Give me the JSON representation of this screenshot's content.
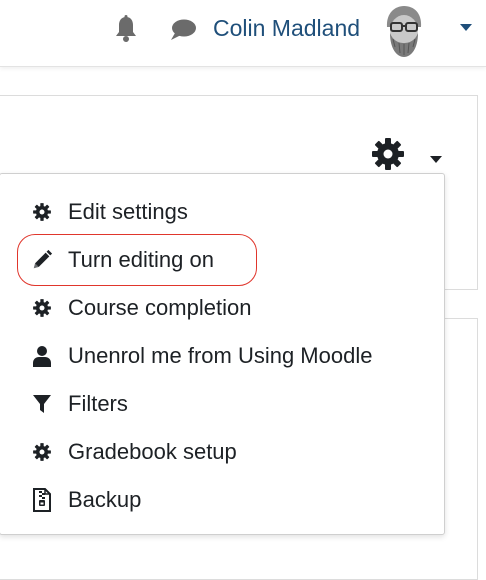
{
  "navbar": {
    "notifications_icon": "bell-icon",
    "messages_icon": "chat-bubble-icon",
    "user_name": "Colin Madland",
    "user_menu_icon": "caret-down-icon"
  },
  "course_actions": {
    "settings_icon": "gear-icon",
    "caret_icon": "caret-down-icon"
  },
  "menu": {
    "items": [
      {
        "label": "Edit settings",
        "icon": "gear-icon"
      },
      {
        "label": "Turn editing on",
        "icon": "pencil-icon"
      },
      {
        "label": "Course completion",
        "icon": "gear-icon"
      },
      {
        "label": "Unenrol me from Using Moodle",
        "icon": "user-icon"
      },
      {
        "label": "Filters",
        "icon": "filter-icon"
      },
      {
        "label": "Gradebook setup",
        "icon": "gear-icon"
      },
      {
        "label": "Backup",
        "icon": "file-archive-icon"
      }
    ],
    "highlighted_index": 1,
    "highlight_color": "#e0362c"
  },
  "colors": {
    "link": "#1f4f7a",
    "icon": "#1d2125",
    "text": "#1d2125"
  }
}
